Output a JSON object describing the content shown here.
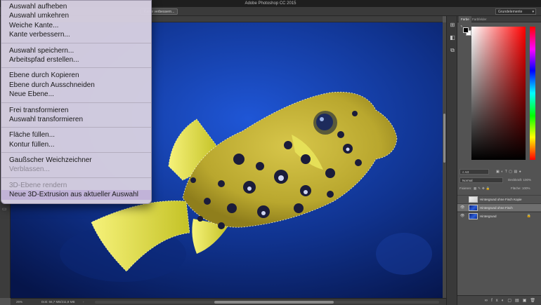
{
  "app": {
    "window_title": "Adobe Photoshop CC 2015",
    "options_bar": {
      "refine_edge_button": "Kante verbessern...",
      "workspace": "Grundelemente"
    }
  },
  "context_menu": {
    "groups": [
      {
        "items": [
          {
            "label": "Auswahl aufheben",
            "enabled": true
          },
          {
            "label": "Auswahl umkehren",
            "enabled": true
          },
          {
            "label": "Weiche Kante...",
            "enabled": true
          },
          {
            "label": "Kante verbessern...",
            "enabled": true
          }
        ]
      },
      {
        "items": [
          {
            "label": "Auswahl speichern...",
            "enabled": true
          },
          {
            "label": "Arbeitspfad erstellen...",
            "enabled": true
          }
        ]
      },
      {
        "items": [
          {
            "label": "Ebene durch Kopieren",
            "enabled": true
          },
          {
            "label": "Ebene durch Ausschneiden",
            "enabled": true
          },
          {
            "label": "Neue Ebene...",
            "enabled": true
          }
        ]
      },
      {
        "items": [
          {
            "label": "Frei transformieren",
            "enabled": true
          },
          {
            "label": "Auswahl transformieren",
            "enabled": true
          }
        ]
      },
      {
        "items": [
          {
            "label": "Fläche füllen...",
            "enabled": true
          },
          {
            "label": "Kontur füllen...",
            "enabled": true
          }
        ]
      },
      {
        "items": [
          {
            "label": "Gaußscher Weichzeichner",
            "enabled": true
          },
          {
            "label": "Verblassen...",
            "enabled": false
          }
        ]
      },
      {
        "items": [
          {
            "label": "3D-Ebene rendern",
            "enabled": false
          },
          {
            "label": "Neue 3D-Extrusion aus aktueller Auswahl",
            "enabled": true
          }
        ]
      }
    ]
  },
  "status_bar": {
    "zoom": "25%",
    "doc_info": "Dok: 66,7 MB/211,8 MB",
    "arrow": "›"
  },
  "color_panel": {
    "tabs": [
      "Farbe",
      "Farbfelder"
    ],
    "foreground": "#000000",
    "background": "#ffffff"
  },
  "layers_panel": {
    "tabs": [
      "Ebenen",
      "Kanäle",
      "Pfade"
    ],
    "kind_filter": "Art",
    "blend_mode": "Normal",
    "opacity_label": "Deckkraft:",
    "opacity_value": "100%",
    "lock_label": "Fixieren:",
    "fill_label": "Fläche:",
    "fill_value": "100%",
    "layers": [
      {
        "name": "Hintergrund ohne Fisch Kopie",
        "visible": false,
        "selected": false,
        "locked": false
      },
      {
        "name": "Hintergrund ohne Fisch",
        "visible": true,
        "selected": true,
        "locked": false
      },
      {
        "name": "Hintergrund",
        "visible": true,
        "selected": false,
        "locked": true
      }
    ]
  }
}
